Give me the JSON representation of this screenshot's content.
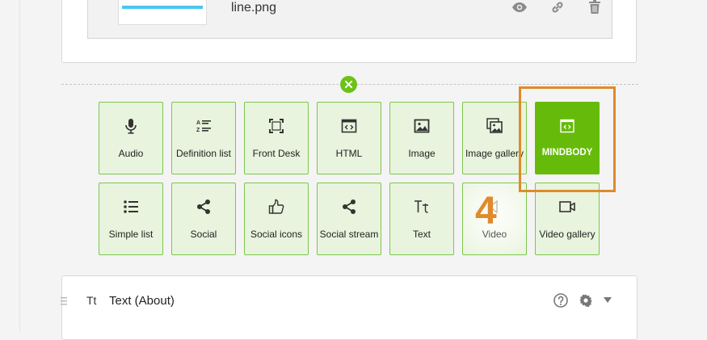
{
  "file": {
    "name": "line.png"
  },
  "widgets": [
    {
      "label": "Audio",
      "icon": "microphone-icon"
    },
    {
      "label": "Definition list",
      "icon": "definition-list-icon"
    },
    {
      "label": "Front Desk",
      "icon": "front-desk-icon"
    },
    {
      "label": "HTML",
      "icon": "html-code-icon"
    },
    {
      "label": "Image",
      "icon": "image-icon"
    },
    {
      "label": "Image gallery",
      "icon": "image-gallery-icon"
    },
    {
      "label": "MINDBODY",
      "icon": "mindbody-code-icon"
    },
    {
      "label": "Simple list",
      "icon": "simple-list-icon"
    },
    {
      "label": "Social",
      "icon": "share-icon"
    },
    {
      "label": "Social icons",
      "icon": "thumbs-up-icon"
    },
    {
      "label": "Social stream",
      "icon": "share-stream-icon"
    },
    {
      "label": "Text",
      "icon": "text-icon"
    },
    {
      "label": "Video",
      "icon": "speaker-icon"
    },
    {
      "label": "Video gallery",
      "icon": "video-camera-icon"
    }
  ],
  "annotation": {
    "step": "4"
  },
  "section": {
    "icon_text": "Tt",
    "title": "Text (About)"
  },
  "colors": {
    "accent": "#66bb0a",
    "tile_bg": "#e8f4dd",
    "tile_border": "#7cc84a",
    "annotation": "#e08a2c"
  }
}
